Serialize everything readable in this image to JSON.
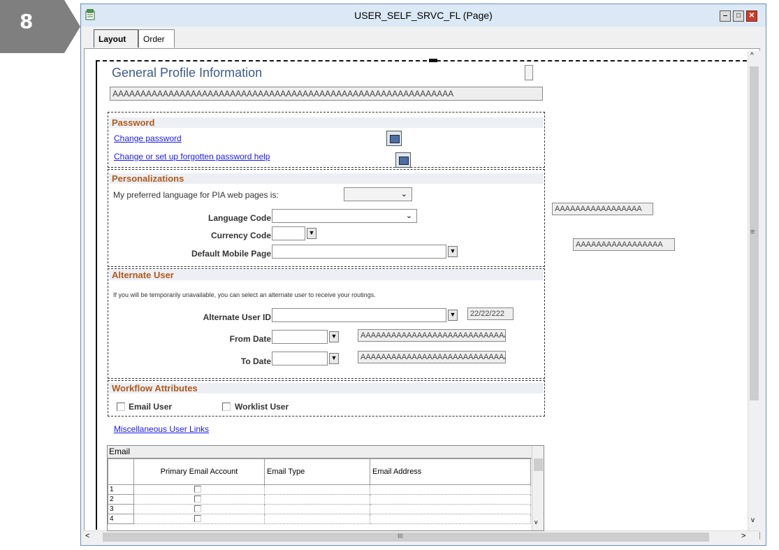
{
  "step": {
    "number": "8",
    "color": "#7f7f7f"
  },
  "window": {
    "title": "USER_SELF_SRVC_FL (Page)",
    "controls": {
      "minimize": "‒",
      "maximize": "□",
      "close": "✕"
    },
    "tabs": [
      {
        "label": "Layout",
        "active": true
      },
      {
        "label": "Order",
        "active": false
      }
    ]
  },
  "page": {
    "title": "General Profile Information",
    "name_placeholder": "AAAAAAAAAAAAAAAAAAAAAAAAAAAAAAAAAAAAAAAAAAAAAAAAAAAAAAAAAAAAA"
  },
  "password": {
    "heading": "Password",
    "change_link": "Change password",
    "forgot_link": "Change or set up forgotten password help"
  },
  "personalizations": {
    "heading": "Personalizations",
    "language_pref_label": "My preferred language for PIA web pages is:",
    "language_code_label": "Language Code",
    "currency_code_label": "Currency Code",
    "mobile_page_label": "Default Mobile Page",
    "side_field_1": "AAAAAAAAAAAAAAAAA",
    "side_field_2": "AAAAAAAAAAAAAAAAA"
  },
  "alternate_user": {
    "heading": "Alternate User",
    "description": "If you will be temporarily unavailable, you can select an alternate user to receive your routings.",
    "user_id_label": "Alternate User ID",
    "date_value": "22/22/222",
    "from_date_label": "From Date",
    "to_date_label": "To Date",
    "from_placeholder": "AAAAAAAAAAAAAAAAAAAAAAAAAAAAA",
    "to_placeholder": "AAAAAAAAAAAAAAAAAAAAAAAAAAAAA"
  },
  "workflow": {
    "heading": "Workflow Attributes",
    "email_user": "Email User",
    "worklist_user": "Worklist User"
  },
  "misc_link": "Miscellaneous User Links",
  "email_grid": {
    "title": "Email",
    "columns": [
      "Primary Email Account",
      "Email Type",
      "Email Address"
    ],
    "rows": [
      "1",
      "2",
      "3",
      "4"
    ]
  },
  "scrollbar": {
    "grip": "≡",
    "hgrip": "III",
    "up": "^",
    "down": "v",
    "left": "<",
    "right": ">"
  }
}
